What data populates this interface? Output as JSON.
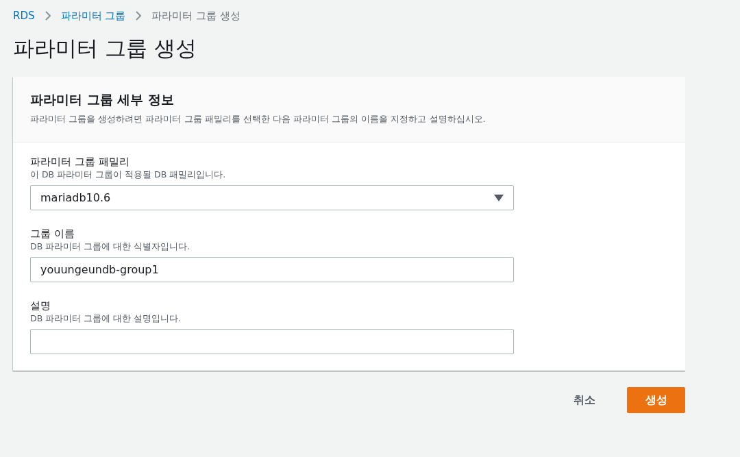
{
  "breadcrumb": [
    {
      "label": "RDS",
      "kind": "link"
    },
    {
      "label": "파라미터 그룹",
      "kind": "link"
    },
    {
      "label": "파라미터 그룹 생성",
      "kind": "current"
    }
  ],
  "page_title": "파라미터 그룹 생성",
  "panel": {
    "title": "파라미터 그룹 세부 정보",
    "description": "파라미터 그룹을 생성하려면 파라미터 그룹 패밀리를 선택한 다음 파라미터 그룹의 이름을 지정하고 설명하십시오.",
    "fields": [
      {
        "kind": "select",
        "label": "파라미터 그룹 패밀리",
        "hint": "이 DB 파라미터 그룹이 적용될 DB 패밀리입니다.",
        "value": "mariadb10.6"
      },
      {
        "kind": "text",
        "label": "그룹 이름",
        "hint": "DB 파라미터 그룹에 대한 식별자입니다.",
        "value": "youungeundb-group1"
      },
      {
        "kind": "text",
        "label": "설명",
        "hint": "DB 파라미터 그룹에 대한 설명입니다."
      }
    ]
  },
  "buttons": [
    {
      "label": "취소",
      "kind": "secondary"
    },
    {
      "label": "생성",
      "kind": "primary"
    }
  ]
}
